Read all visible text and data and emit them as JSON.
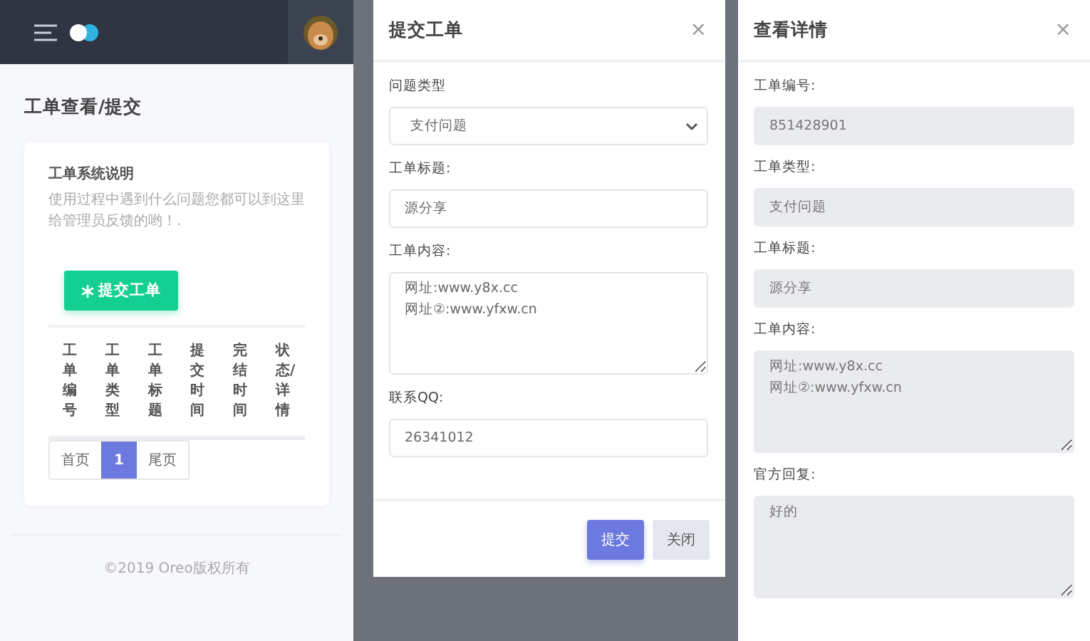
{
  "page": {
    "title": "工单查看/提交",
    "notice": {
      "title": "工单系统说明",
      "text": "使用过程中遇到什么问题您都可以到这里给管理员反馈的哟！."
    },
    "submit_button": "提交工单",
    "table": {
      "columns": [
        "工单编号",
        "工单类型",
        "工单标题",
        "提交时间",
        "完结时间",
        "状态/详情"
      ]
    },
    "pagination": [
      {
        "label": "首页",
        "selected": false
      },
      {
        "label": "1",
        "selected": true
      },
      {
        "label": "尾页",
        "selected": false
      }
    ],
    "footer": "©2019 Oreo版权所有"
  },
  "submit_dialog": {
    "title": "提交工单",
    "close": "×",
    "fields": [
      {
        "kind": "select",
        "label": "问题类型",
        "value": "支付问题"
      },
      {
        "kind": "input",
        "label": "工单标题:",
        "value": "源分享"
      },
      {
        "kind": "textarea",
        "label": "工单内容:",
        "value": "网址:www.y8x.cc\n网址②:www.yfxw.cn"
      },
      {
        "kind": "input",
        "label": "联系QQ:",
        "value": "26341012"
      }
    ],
    "buttons": [
      {
        "kind": "primary",
        "label": "提交"
      },
      {
        "kind": "secondary",
        "label": "关闭"
      }
    ]
  },
  "detail_dialog": {
    "title": "查看详情",
    "close": "×",
    "fields": [
      {
        "kind": "input",
        "label": "工单编号:",
        "value": "851428901"
      },
      {
        "kind": "input",
        "label": "工单类型:",
        "value": "支付问题"
      },
      {
        "kind": "input",
        "label": "工单标题:",
        "value": "源分享"
      },
      {
        "kind": "textarea",
        "label": "工单内容:",
        "value": "网址:www.y8x.cc\n网址②:www.yfxw.cn"
      },
      {
        "kind": "textarea",
        "label": "官方回复:",
        "value": "好的"
      }
    ]
  }
}
